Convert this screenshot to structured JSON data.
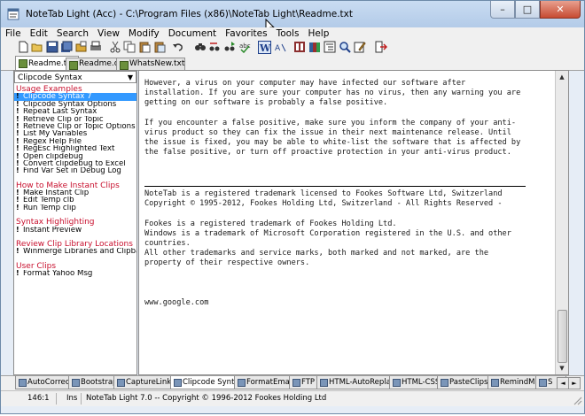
{
  "window": {
    "title": "NoteTab Light (Acc)  -  C:\\Program Files (x86)\\NoteTab Light\\Readme.txt",
    "minimize_label": "–",
    "maximize_label": "□",
    "close_label": "✕"
  },
  "menu": [
    "File",
    "Edit",
    "Search",
    "View",
    "Modify",
    "Document",
    "Favorites",
    "Tools",
    "Help"
  ],
  "toolbar": {
    "buttons": [
      "new-icon",
      "open-icon",
      "save-icon",
      "save-all-icon",
      "open-folder-icon",
      "print-icon",
      "cut-icon",
      "copy-icon",
      "paste-icon",
      "paste-special-icon",
      "undo-icon",
      "find-icon",
      "replace-icon",
      "find-next-icon",
      "spell-check-icon",
      "word-wrap-icon",
      "font-size-icon",
      "document-properties-icon",
      "library-icon",
      "outline-icon",
      "quick-search-icon",
      "edit-clip-icon",
      "exit-icon"
    ]
  },
  "doc_tabs": [
    {
      "label": "Readme.txt",
      "active": true
    },
    {
      "label": "Readme.otl",
      "active": false
    },
    {
      "label": "WhatsNew.txt",
      "active": false
    }
  ],
  "left_panel": {
    "library_select": "Clipcode Syntax",
    "groups": [
      {
        "heading": "Usage Examples",
        "items": [
          "Clipcode Syntax 7",
          "Clipcode Syntax Options",
          "Repeat Last Syntax",
          "Retrieve Clip or Topic",
          "Retrieve Clip or Topic Options",
          "List My Variables",
          "Regex Help File",
          "RegEsc Highlighted Text",
          "Open clipdebug",
          "Convert clipdebug to Excel",
          "Find Var Set in Debug Log"
        ],
        "selected": 0
      },
      {
        "heading": "How to Make Instant Clips",
        "items": [
          "Make Instant Clip",
          "Edit Temp clb",
          "Run Temp clip"
        ]
      },
      {
        "heading": "Syntax Highlighting",
        "items": [
          "Instant Preview"
        ]
      },
      {
        "heading": "Review Clip Library Locations",
        "items": [
          "Winmerge Libraries and Clipbars"
        ]
      },
      {
        "heading": "User Clips",
        "items": [
          "Format Yahoo Msg"
        ]
      }
    ]
  },
  "editor": {
    "block1": "However, a virus on your computer may have infected our software after\ninstallation. If you are sure your computer has no virus, then any warning you are\ngetting on our software is probably a false positive.\n\nIf you encounter a false positive, make sure you inform the company of your anti-\nvirus product so they can fix the issue in their next maintenance release. Until\nthe issue is fixed, you may be able to white-list the software that is affected by\nthe false positive, or turn off proactive protection in your anti-virus product.",
    "block2": "NoteTab is a registered trademark licensed to Fookes Software Ltd, Switzerland\nCopyright © 1995-2012, Fookes Holding Ltd, Switzerland - All Rights Reserved -\n\nFookes is a registered trademark of Fookes Holding Ltd.\nWindows is a trademark of Microsoft Corporation registered in the U.S. and other\ncountries.\nAll other trademarks and service marks, both marked and not marked, are the\nproperty of their respective owners.\n\n\n\nwww.google.com"
  },
  "clip_tabs": [
    {
      "label": "AutoCorrect",
      "active": false
    },
    {
      "label": "Bootstrap",
      "active": false
    },
    {
      "label": "CaptureLinks",
      "active": false
    },
    {
      "label": "Clipcode Syntax",
      "active": true
    },
    {
      "label": "FormatEmail",
      "active": false
    },
    {
      "label": "FTP",
      "active": false
    },
    {
      "label": "HTML-AutoReplace",
      "active": false
    },
    {
      "label": "HTML-CSS",
      "active": false
    },
    {
      "label": "PasteClips",
      "active": false
    },
    {
      "label": "RemindMe",
      "active": false
    },
    {
      "label": "S",
      "active": false
    }
  ],
  "status": {
    "position": "146:1",
    "mode": "Ins",
    "info": "NoteTab Light 7.0 -- Copyright © 1996-2012 Fookes Holding Ltd"
  }
}
